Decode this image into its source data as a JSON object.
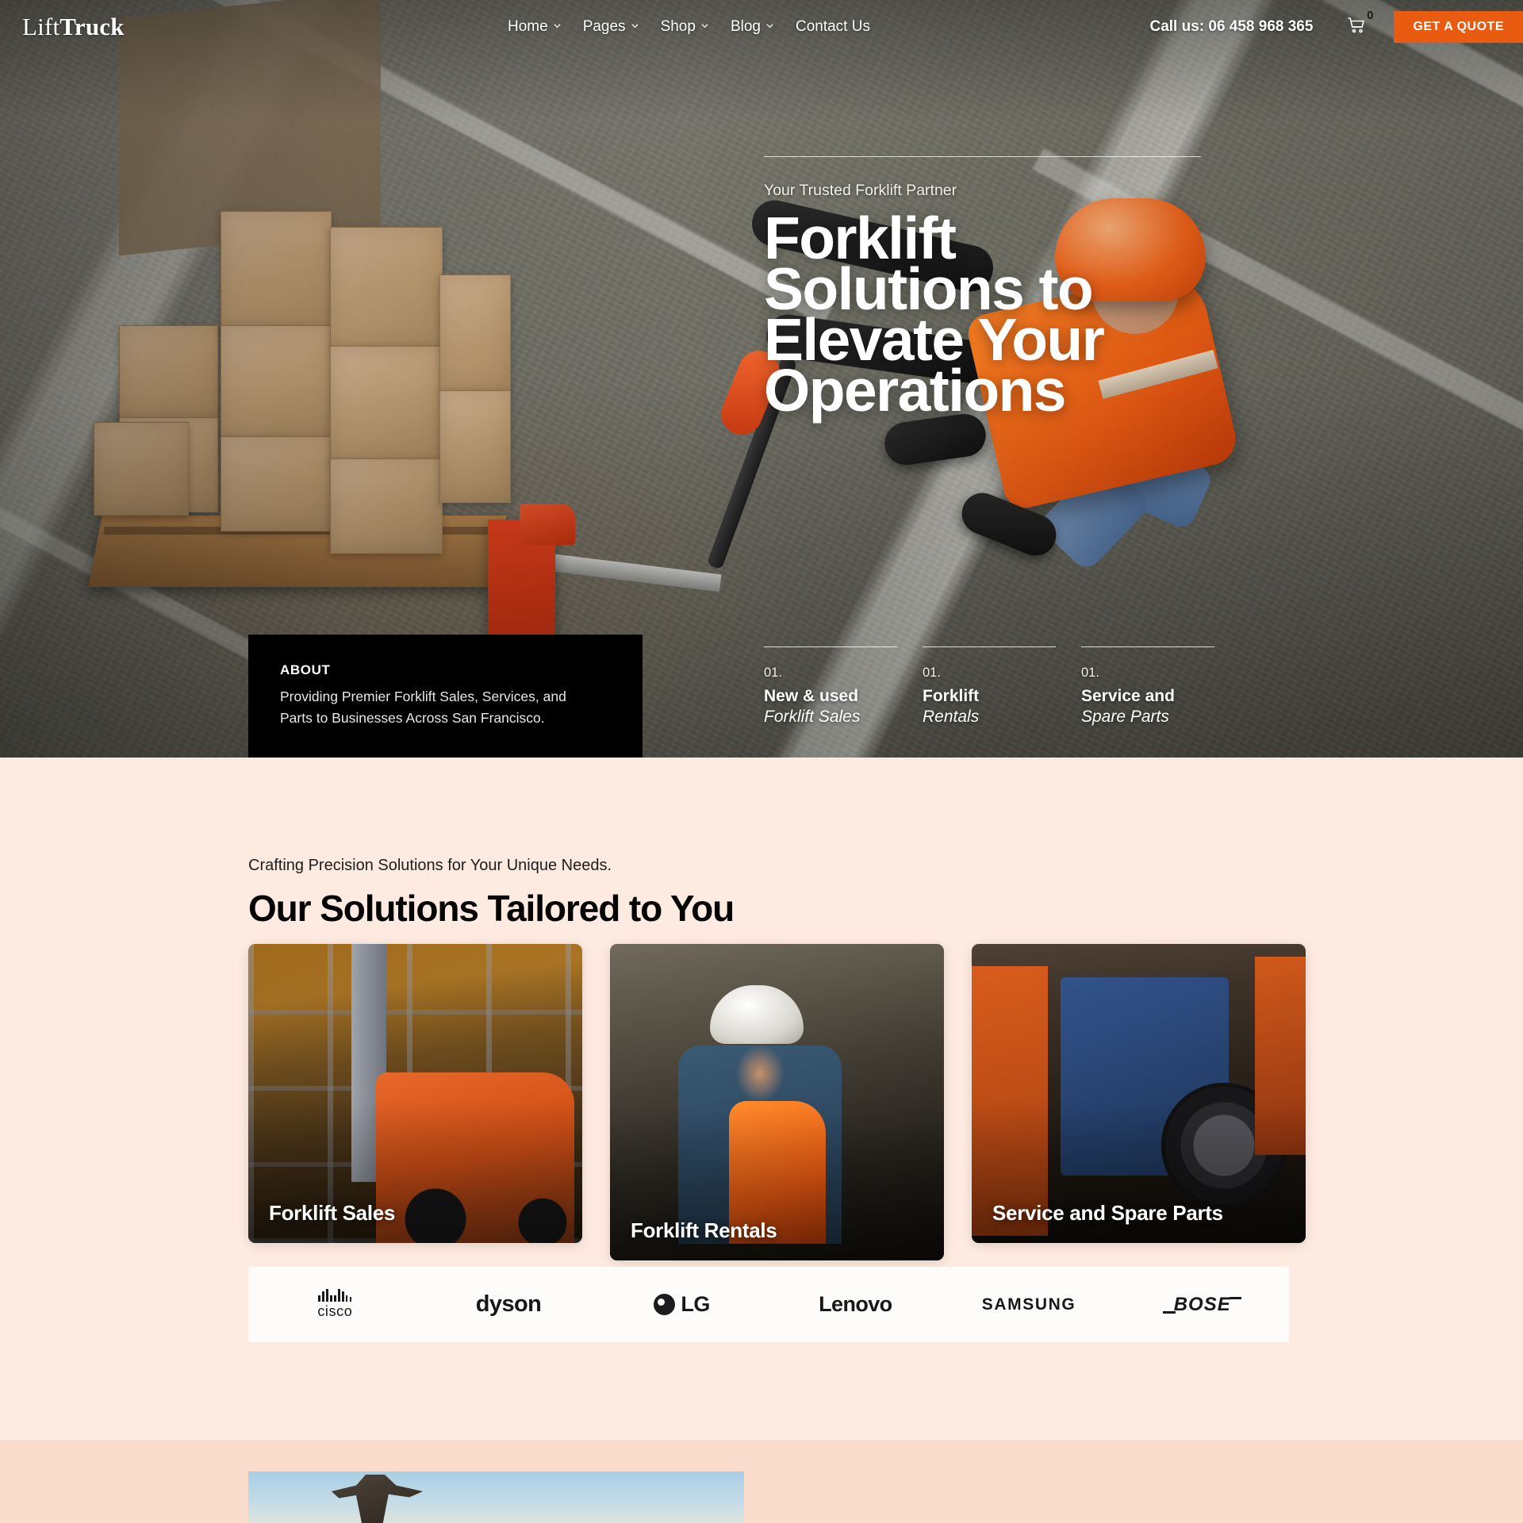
{
  "site": {
    "logo_thin": "Lift",
    "logo_bold": "Truck"
  },
  "nav": {
    "items": [
      {
        "label": "Home",
        "has_dropdown": true
      },
      {
        "label": "Pages",
        "has_dropdown": true
      },
      {
        "label": "Shop",
        "has_dropdown": true
      },
      {
        "label": "Blog",
        "has_dropdown": true
      },
      {
        "label": "Contact Us",
        "has_dropdown": false
      }
    ],
    "phone_label": "Call us: 06 458 968 365",
    "cart_count": "0",
    "cart_icon": "shopping-cart-icon",
    "cta_label": "GET A QUOTE",
    "cta_color": "#e85b10"
  },
  "hero": {
    "eyebrow": "Your Trusted Forklift Partner",
    "title_lines": [
      "Forklift",
      "Solutions to",
      "Elevate Your",
      "Operations"
    ],
    "about": {
      "label": "ABOUT",
      "text": "Providing Premier Forklift Sales, Services, and Parts to Businesses Across San Francisco."
    },
    "features": [
      {
        "num": "01.",
        "line1": "New & used",
        "line2": "Forklift Sales"
      },
      {
        "num": "01.",
        "line1": "Forklift",
        "line2": "Rentals"
      },
      {
        "num": "01.",
        "line1": "Service and",
        "line2": "Spare Parts"
      }
    ]
  },
  "solutions": {
    "eyebrow": "Crafting Precision Solutions for Your Unique Needs.",
    "title": "Our Solutions Tailored to You",
    "cards": [
      {
        "label": "Forklift Sales"
      },
      {
        "label": "Forklift Rentals"
      },
      {
        "label": "Service and Spare Parts"
      }
    ]
  },
  "brands": [
    {
      "name": "cisco"
    },
    {
      "name": "dyson"
    },
    {
      "name": "LG"
    },
    {
      "name": "Lenovo"
    },
    {
      "name": "SAMSUNG"
    },
    {
      "name": "BOSE"
    }
  ],
  "colors": {
    "accent_orange": "#e85b10",
    "section_peach": "#fdeae0",
    "next_section_peach": "#f9dccb",
    "panel_black": "#000000"
  }
}
